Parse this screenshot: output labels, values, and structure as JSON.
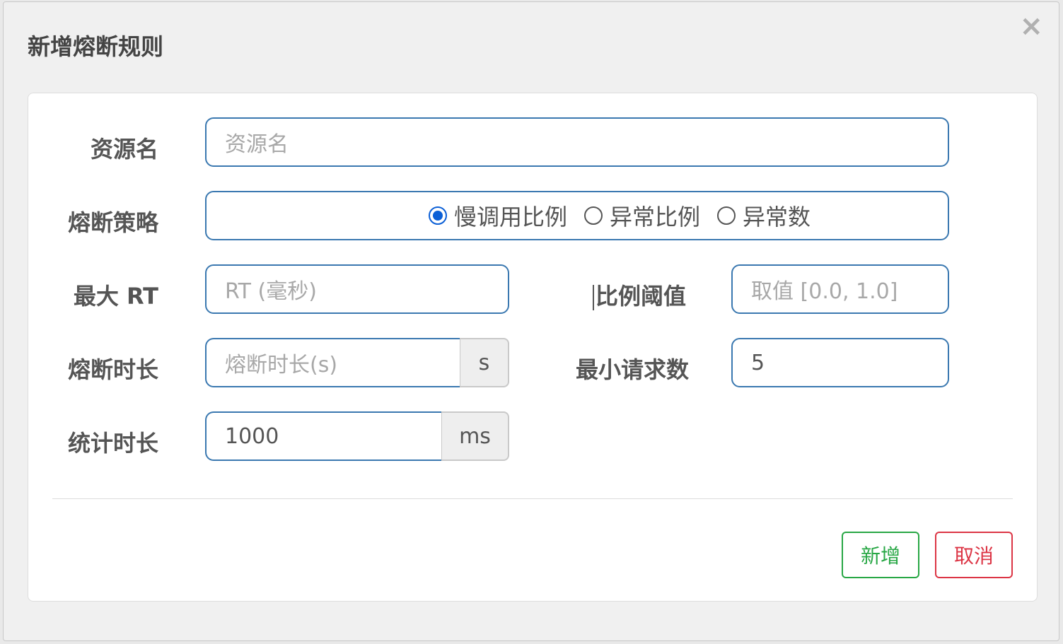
{
  "dialog": {
    "title": "新增熔断规则",
    "close_label": "×"
  },
  "form": {
    "resource": {
      "label": "资源名",
      "placeholder": "资源名",
      "value": ""
    },
    "strategy": {
      "label": "熔断策略",
      "options": [
        {
          "label": "慢调用比例",
          "checked": true
        },
        {
          "label": "异常比例",
          "checked": false
        },
        {
          "label": "异常数",
          "checked": false
        }
      ]
    },
    "max_rt": {
      "label": "最大 RT",
      "placeholder": "RT (毫秒)",
      "value": ""
    },
    "ratio_threshold": {
      "label": "比例阈值",
      "placeholder": "取值 [0.0, 1.0]",
      "value": ""
    },
    "duration": {
      "label": "熔断时长",
      "placeholder": "熔断时长(s)",
      "value": "",
      "unit": "s"
    },
    "min_requests": {
      "label": "最小请求数",
      "value": "5"
    },
    "stat_duration": {
      "label": "统计时长",
      "value": "1000",
      "unit": "ms"
    }
  },
  "buttons": {
    "add_label": "新增",
    "cancel_label": "取消"
  },
  "colors": {
    "input_border": "#3a78b0",
    "radio_accent": "#0b5fd6",
    "add_button": "#28a745",
    "cancel_button": "#dc3545"
  }
}
